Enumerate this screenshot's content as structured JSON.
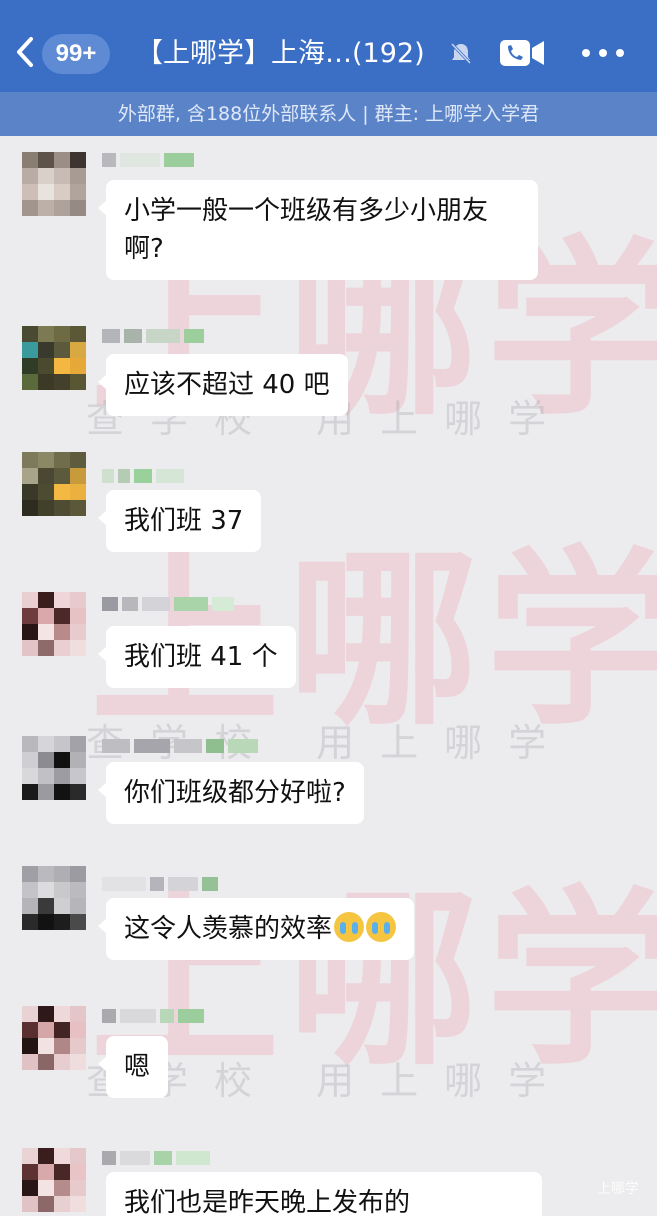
{
  "header": {
    "back_label": "",
    "unread_badge": "99+",
    "title": "【上哪学】上海…(192)",
    "subtitle": "外部群, 含188位外部联系人 | 群主: 上哪学入学君"
  },
  "watermarks": {
    "big": "上哪学",
    "small": "查学校  用上哪学",
    "corner": "上哪学"
  },
  "messages": [
    {
      "text": "小学一般一个班级有多少小朋友啊?"
    },
    {
      "text": "应该不超过 40 吧"
    },
    {
      "text": "我们班 37"
    },
    {
      "text": "我们班 41 个"
    },
    {
      "text": "你们班级都分好啦?"
    },
    {
      "text": "这令人羡慕的效率"
    },
    {
      "text": "嗯"
    },
    {
      "text": "我们也是昨天晚上发布的"
    }
  ],
  "colors": {
    "header_bg": "#3b6fc6",
    "subheader_bg": "#5b84c8",
    "chat_bg": "#ececee",
    "bubble_bg": "#ffffff"
  },
  "icons": {
    "back": "chevron-left-icon",
    "mute": "bell-muted-icon",
    "call": "video-call-icon",
    "more": "more-dots-icon"
  }
}
